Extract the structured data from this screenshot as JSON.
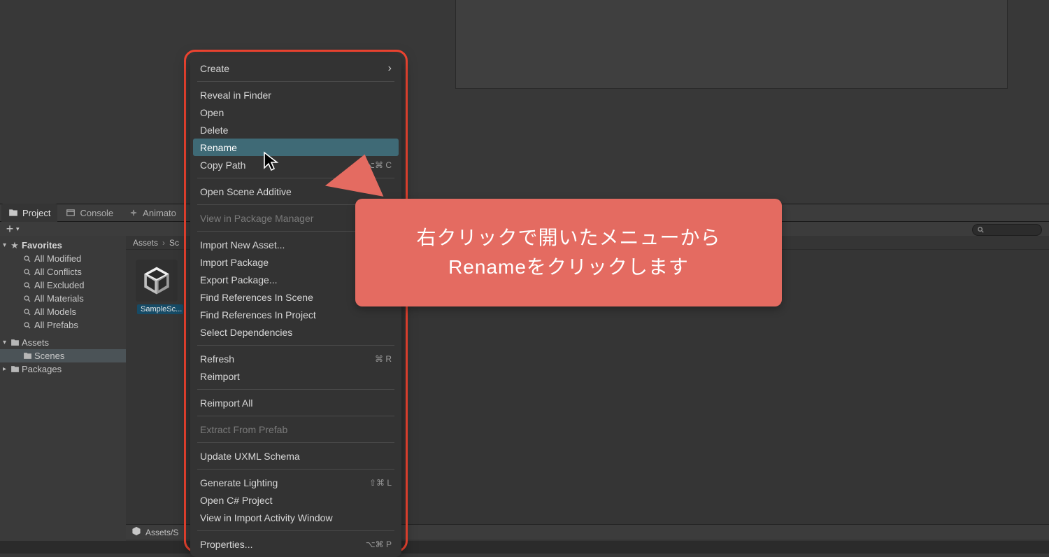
{
  "tabs": {
    "project": "Project",
    "console": "Console",
    "animator": "Animato"
  },
  "favorites": {
    "header": "Favorites",
    "items": [
      "All Modified",
      "All Conflicts",
      "All Excluded",
      "All Materials",
      "All Models",
      "All Prefabs"
    ]
  },
  "assetsTree": {
    "assets": "Assets",
    "scenes": "Scenes",
    "packages": "Packages"
  },
  "breadcrumb": {
    "root": "Assets",
    "sep": "›",
    "next": "Sc"
  },
  "tile": {
    "caption": "SampleSc..."
  },
  "search": {
    "placeholder": ""
  },
  "statusbar": {
    "path": "Assets/S"
  },
  "contextMenu": {
    "create": "Create",
    "reveal": "Reveal in Finder",
    "open": "Open",
    "delete": "Delete",
    "rename": "Rename",
    "copyPath": "Copy Path",
    "copyPathShortcut": "⌥⌘ C",
    "openSceneAdditive": "Open Scene Additive",
    "viewPkg": "View in Package Manager",
    "importNew": "Import New Asset...",
    "importPkg": "Import Package",
    "exportPkg": "Export Package...",
    "findScene": "Find References In Scene",
    "findProject": "Find References In Project",
    "selectDeps": "Select Dependencies",
    "refresh": "Refresh",
    "refreshShortcut": "⌘ R",
    "reimport": "Reimport",
    "reimportAll": "Reimport All",
    "extract": "Extract From Prefab",
    "updateUxml": "Update UXML Schema",
    "genLight": "Generate Lighting",
    "genLightShortcut": "⇧⌘ L",
    "openCs": "Open C# Project",
    "importActivity": "View in Import Activity Window",
    "properties": "Properties...",
    "propertiesShortcut": "⌥⌘ P"
  },
  "callout": {
    "line1": "右クリックで開いたメニューから",
    "line2": "Renameをクリックします"
  }
}
